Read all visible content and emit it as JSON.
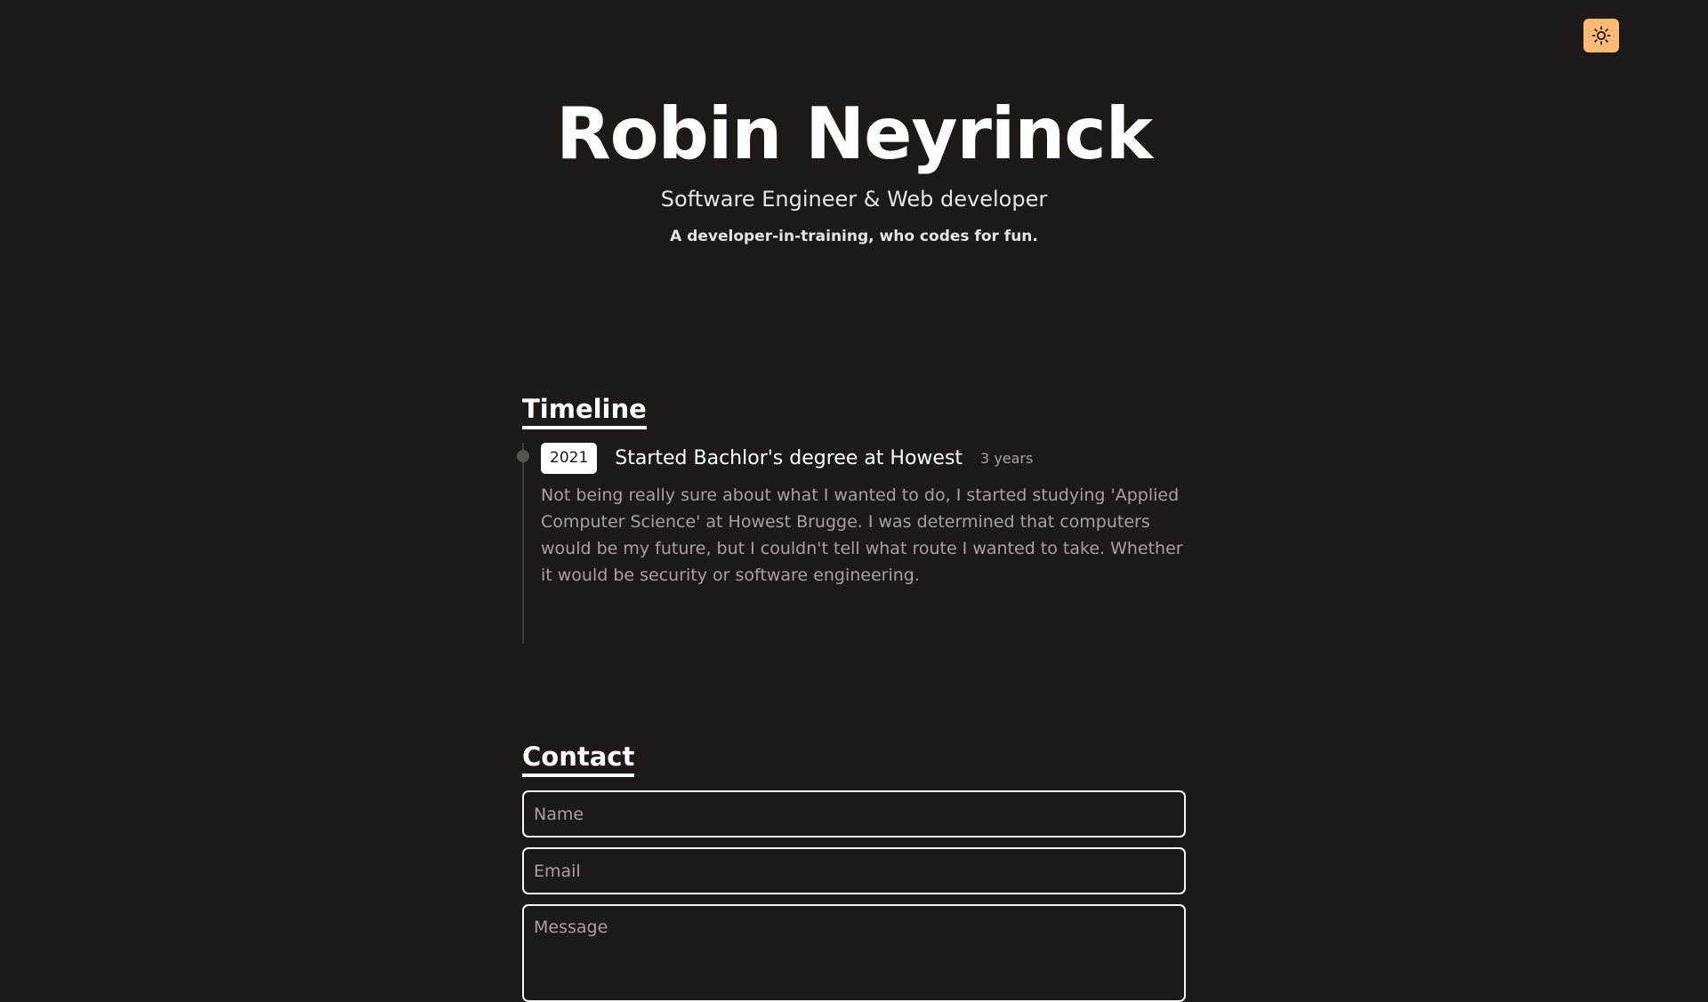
{
  "header": {
    "theme_toggle_icon": "sun-icon",
    "accent_color": "#fdba74"
  },
  "hero": {
    "name": "Robin Neyrinck",
    "subtitle": "Software Engineer & Web developer",
    "tagline": "A developer-in-training, who codes for fun."
  },
  "timeline": {
    "title": "Timeline",
    "items": [
      {
        "year": "2021",
        "title": "Started Bachlor's degree at Howest",
        "duration": "3 years",
        "description": "Not being really sure about what I wanted to do, I started studying 'Applied Computer Science' at Howest Brugge. I was determined that computers would be my future, but I couldn't tell what route I wanted to take. Whether it would be security or software engineering."
      }
    ]
  },
  "contact": {
    "title": "Contact",
    "name_placeholder": "Name",
    "email_placeholder": "Email",
    "message_placeholder": "Message"
  }
}
